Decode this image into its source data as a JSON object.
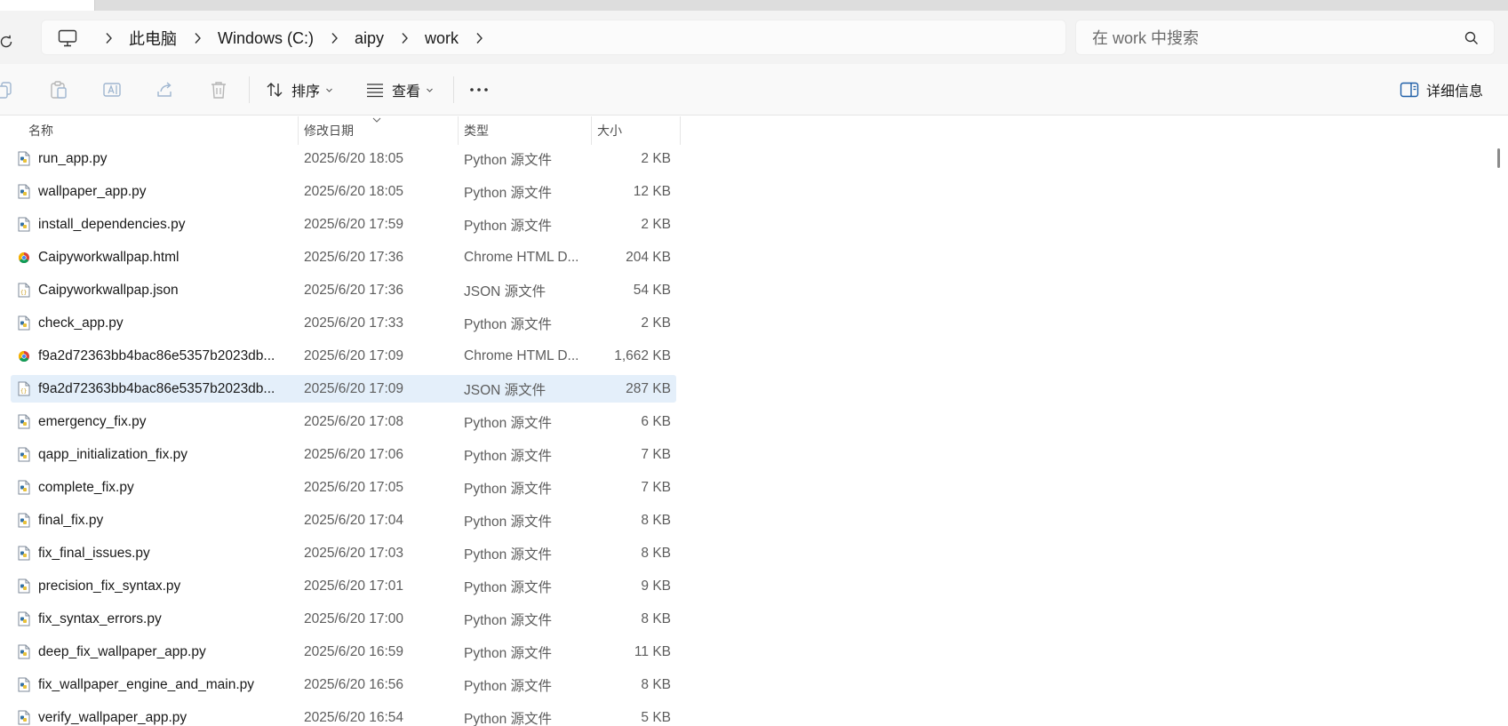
{
  "breadcrumb": {
    "items": [
      {
        "label": "此电脑"
      },
      {
        "label": "Windows (C:)"
      },
      {
        "label": "aipy"
      },
      {
        "label": "work"
      }
    ]
  },
  "search": {
    "placeholder": "在 work 中搜索"
  },
  "toolbar": {
    "sort_label": "排序",
    "view_label": "查看",
    "details_label": "详细信息"
  },
  "columns": {
    "name": "名称",
    "date": "修改日期",
    "type": "类型",
    "size": "大小"
  },
  "files": [
    {
      "name": "run_app.py",
      "date": "2025/6/20 18:05",
      "type": "Python 源文件",
      "size": "2 KB",
      "icon": "python-file-icon"
    },
    {
      "name": "wallpaper_app.py",
      "date": "2025/6/20 18:05",
      "type": "Python 源文件",
      "size": "12 KB",
      "icon": "python-file-icon"
    },
    {
      "name": "install_dependencies.py",
      "date": "2025/6/20 17:59",
      "type": "Python 源文件",
      "size": "2 KB",
      "icon": "python-file-icon"
    },
    {
      "name": "Caipyworkwallpap.html",
      "date": "2025/6/20 17:36",
      "type": "Chrome HTML D...",
      "size": "204 KB",
      "icon": "chrome-html-icon"
    },
    {
      "name": "Caipyworkwallpap.json",
      "date": "2025/6/20 17:36",
      "type": "JSON 源文件",
      "size": "54 KB",
      "icon": "json-file-icon"
    },
    {
      "name": "check_app.py",
      "date": "2025/6/20 17:33",
      "type": "Python 源文件",
      "size": "2 KB",
      "icon": "python-file-icon"
    },
    {
      "name": "f9a2d72363bb4bac86e5357b2023db...",
      "date": "2025/6/20 17:09",
      "type": "Chrome HTML D...",
      "size": "1,662 KB",
      "icon": "chrome-html-icon"
    },
    {
      "name": "f9a2d72363bb4bac86e5357b2023db...",
      "date": "2025/6/20 17:09",
      "type": "JSON 源文件",
      "size": "287 KB",
      "icon": "json-file-icon",
      "selected": true
    },
    {
      "name": "emergency_fix.py",
      "date": "2025/6/20 17:08",
      "type": "Python 源文件",
      "size": "6 KB",
      "icon": "python-file-icon"
    },
    {
      "name": "qapp_initialization_fix.py",
      "date": "2025/6/20 17:06",
      "type": "Python 源文件",
      "size": "7 KB",
      "icon": "python-file-icon"
    },
    {
      "name": "complete_fix.py",
      "date": "2025/6/20 17:05",
      "type": "Python 源文件",
      "size": "7 KB",
      "icon": "python-file-icon"
    },
    {
      "name": "final_fix.py",
      "date": "2025/6/20 17:04",
      "type": "Python 源文件",
      "size": "8 KB",
      "icon": "python-file-icon"
    },
    {
      "name": "fix_final_issues.py",
      "date": "2025/6/20 17:03",
      "type": "Python 源文件",
      "size": "8 KB",
      "icon": "python-file-icon"
    },
    {
      "name": "precision_fix_syntax.py",
      "date": "2025/6/20 17:01",
      "type": "Python 源文件",
      "size": "9 KB",
      "icon": "python-file-icon"
    },
    {
      "name": "fix_syntax_errors.py",
      "date": "2025/6/20 17:00",
      "type": "Python 源文件",
      "size": "8 KB",
      "icon": "python-file-icon"
    },
    {
      "name": "deep_fix_wallpaper_app.py",
      "date": "2025/6/20 16:59",
      "type": "Python 源文件",
      "size": "11 KB",
      "icon": "python-file-icon"
    },
    {
      "name": "fix_wallpaper_engine_and_main.py",
      "date": "2025/6/20 16:56",
      "type": "Python 源文件",
      "size": "8 KB",
      "icon": "python-file-icon"
    },
    {
      "name": "verify_wallpaper_app.py",
      "date": "2025/6/20 16:54",
      "type": "Python 源文件",
      "size": "5 KB",
      "icon": "python-file-icon"
    }
  ]
}
